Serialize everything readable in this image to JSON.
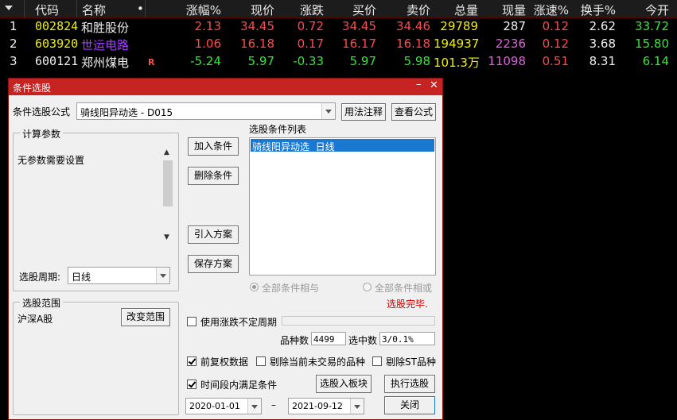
{
  "quote": {
    "headers": [
      "代码",
      "名称",
      "•",
      "涨幅%",
      "现价",
      "涨跌",
      "买价",
      "卖价",
      "总量",
      "现量",
      "涨速%",
      "换手%",
      "今开"
    ],
    "rows": [
      {
        "idx": "1",
        "code": "002824",
        "name": "和胜股份",
        "flag": "",
        "chg_pct": "2.13",
        "price": "34.45",
        "chg": "0.72",
        "bid": "34.45",
        "ask": "34.46",
        "volume": "29789",
        "cur_vol": "287",
        "speed": "0.12",
        "turnover": "2.62",
        "open": "33.72"
      },
      {
        "idx": "2",
        "code": "603920",
        "name": "世运电路",
        "flag": "",
        "chg_pct": "1.06",
        "price": "16.18",
        "chg": "0.17",
        "bid": "16.17",
        "ask": "16.18",
        "volume": "194937",
        "cur_vol": "2236",
        "speed": "0.12",
        "turnover": "3.68",
        "open": "15.80"
      },
      {
        "idx": "3",
        "code": "600121",
        "name": "郑州煤电",
        "flag": "R",
        "chg_pct": "-5.24",
        "price": "5.97",
        "chg": "-0.33",
        "bid": "5.97",
        "ask": "5.98",
        "volume": "101.3万",
        "cur_vol": "11098",
        "speed": "0.51",
        "turnover": "8.31",
        "open": "6.14"
      }
    ],
    "colors": {
      "up": "#ff4a4a",
      "down": "#33e833",
      "neutral": "#f0f0f0",
      "code": "#f0f000",
      "volume": "#f0f000",
      "cur_vol": "#e060e0",
      "name_purple": "#a040ff"
    }
  },
  "dialog": {
    "title": "条件选股",
    "formula_label": "条件选股公式",
    "formula_value": "骑线阳异动选 - D015",
    "usage_button": "用法注释",
    "view_formula_button": "查看公式",
    "params_group": "计算参数",
    "params_text": "无参数需要设置",
    "period_label": "选股周期:",
    "period_value": "日线",
    "add_condition": "加入条件",
    "delete_condition": "删除条件",
    "import_plan": "引入方案",
    "save_plan": "保存方案",
    "condition_list_label": "选股条件列表",
    "conditions": [
      "骑线阳异动选  日线"
    ],
    "radio_and": "全部条件相与",
    "radio_or": "全部条件相或",
    "status": "选股完毕.",
    "scope_group": "选股范围",
    "scope_value": "沪深A股",
    "change_scope": "改变范围",
    "use_variable_period": "使用涨跌不定周期",
    "count_label": "品种数",
    "count_value": "4499",
    "selected_label": "选中数",
    "selected_value": "3/0.1%",
    "forward_adjust": "前复权数据",
    "exclude_untraded": "剔除当前未交易的品种",
    "exclude_st": "剔除ST品种",
    "time_range": "时间段内满足条件",
    "to_block": "选股入板块",
    "execute": "执行选股",
    "close": "关闭",
    "date_from": "2020-01-01",
    "date_sep": "–",
    "date_to": "2021-09-12"
  },
  "icons": {
    "minimize": "minimize-icon",
    "close": "close-icon",
    "dropdown": "chevron-down-icon"
  }
}
